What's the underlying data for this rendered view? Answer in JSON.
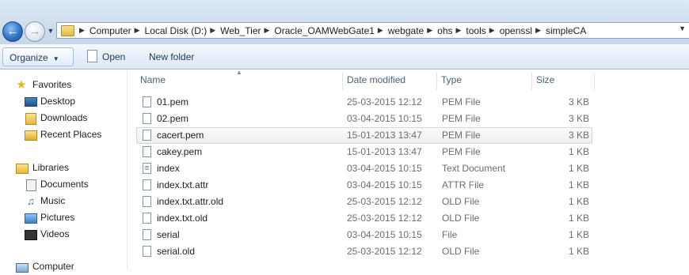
{
  "address": {
    "breadcrumbs": [
      "Computer",
      "Local Disk (D:)",
      "Web_Tier",
      "Oracle_OAMWebGate1",
      "webgate",
      "ohs",
      "tools",
      "openssl",
      "simpleCA"
    ]
  },
  "toolbar": {
    "organize_label": "Organize",
    "open_label": "Open",
    "new_folder_label": "New folder"
  },
  "nav": {
    "favorites": "Favorites",
    "desktop": "Desktop",
    "downloads": "Downloads",
    "recent_places": "Recent Places",
    "libraries": "Libraries",
    "documents": "Documents",
    "music": "Music",
    "pictures": "Pictures",
    "videos": "Videos",
    "computer": "Computer"
  },
  "columns": {
    "name": "Name",
    "date_modified": "Date modified",
    "type": "Type",
    "size": "Size"
  },
  "files": [
    {
      "name": "01.pem",
      "date": "25-03-2015 12:12",
      "type": "PEM File",
      "size": "3 KB"
    },
    {
      "name": "02.pem",
      "date": "03-04-2015 10:15",
      "type": "PEM File",
      "size": "3 KB"
    },
    {
      "name": "cacert.pem",
      "date": "15-01-2013 13:47",
      "type": "PEM File",
      "size": "3 KB"
    },
    {
      "name": "cakey.pem",
      "date": "15-01-2013 13:47",
      "type": "PEM File",
      "size": "1 KB"
    },
    {
      "name": "index",
      "date": "03-04-2015 10:15",
      "type": "Text Document",
      "size": "1 KB"
    },
    {
      "name": "index.txt.attr",
      "date": "03-04-2015 10:15",
      "type": "ATTR File",
      "size": "1 KB"
    },
    {
      "name": "index.txt.attr.old",
      "date": "25-03-2015 12:12",
      "type": "OLD File",
      "size": "1 KB"
    },
    {
      "name": "index.txt.old",
      "date": "25-03-2015 12:12",
      "type": "OLD File",
      "size": "1 KB"
    },
    {
      "name": "serial",
      "date": "03-04-2015 10:15",
      "type": "File",
      "size": "1 KB"
    },
    {
      "name": "serial.old",
      "date": "25-03-2015 12:12",
      "type": "OLD File",
      "size": "1 KB"
    }
  ],
  "selected_file": "cacert.pem"
}
